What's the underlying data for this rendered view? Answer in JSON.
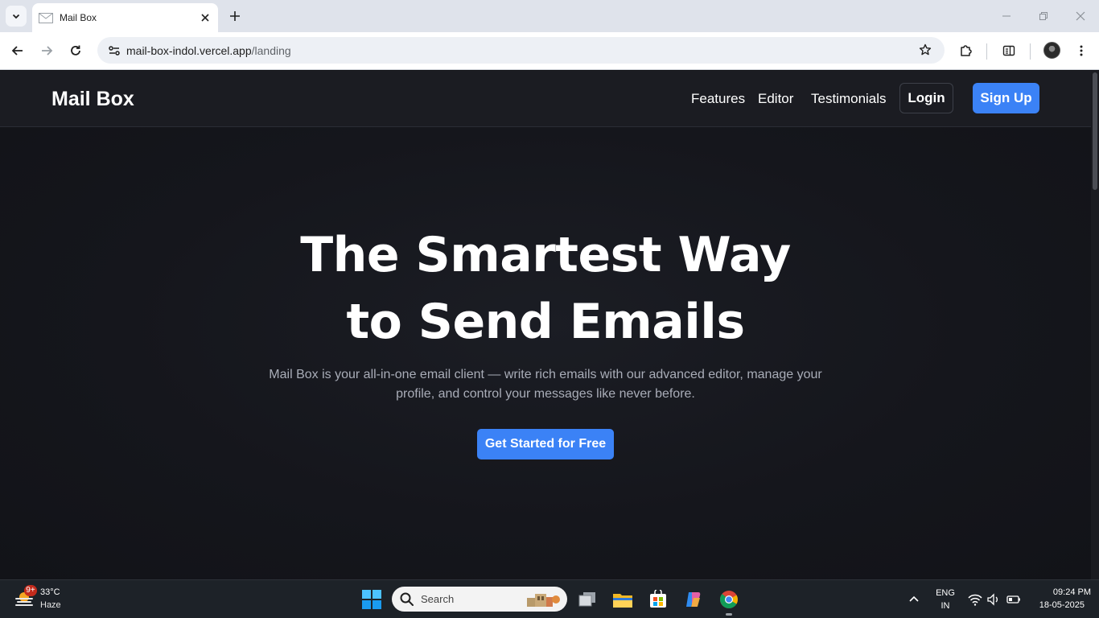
{
  "browser": {
    "tab_title": "Mail Box",
    "url_host": "mail-box-indol.vercel.app",
    "url_path": "/landing"
  },
  "site": {
    "brand": "Mail Box",
    "nav": {
      "features": "Features",
      "editor": "Editor",
      "testimonials": "Testimonials",
      "login": "Login",
      "signup": "Sign Up"
    },
    "hero": {
      "title_line1": "The Smartest Way",
      "title_line2": "to Send Emails",
      "subtitle": "Mail Box is your all-in-one email client — write rich emails with our advanced editor, manage your profile, and control your messages like never before.",
      "cta": "Get Started for Free"
    },
    "colors": {
      "accent": "#3b82f6",
      "background": "#121318",
      "nav_background": "#1b1c22"
    }
  },
  "taskbar": {
    "weather_badge": "9+",
    "temperature": "33°C",
    "condition": "Haze",
    "search_placeholder": "Search",
    "lang_line1": "ENG",
    "lang_line2": "IN",
    "time": "09:24 PM",
    "date": "18-05-2025"
  }
}
